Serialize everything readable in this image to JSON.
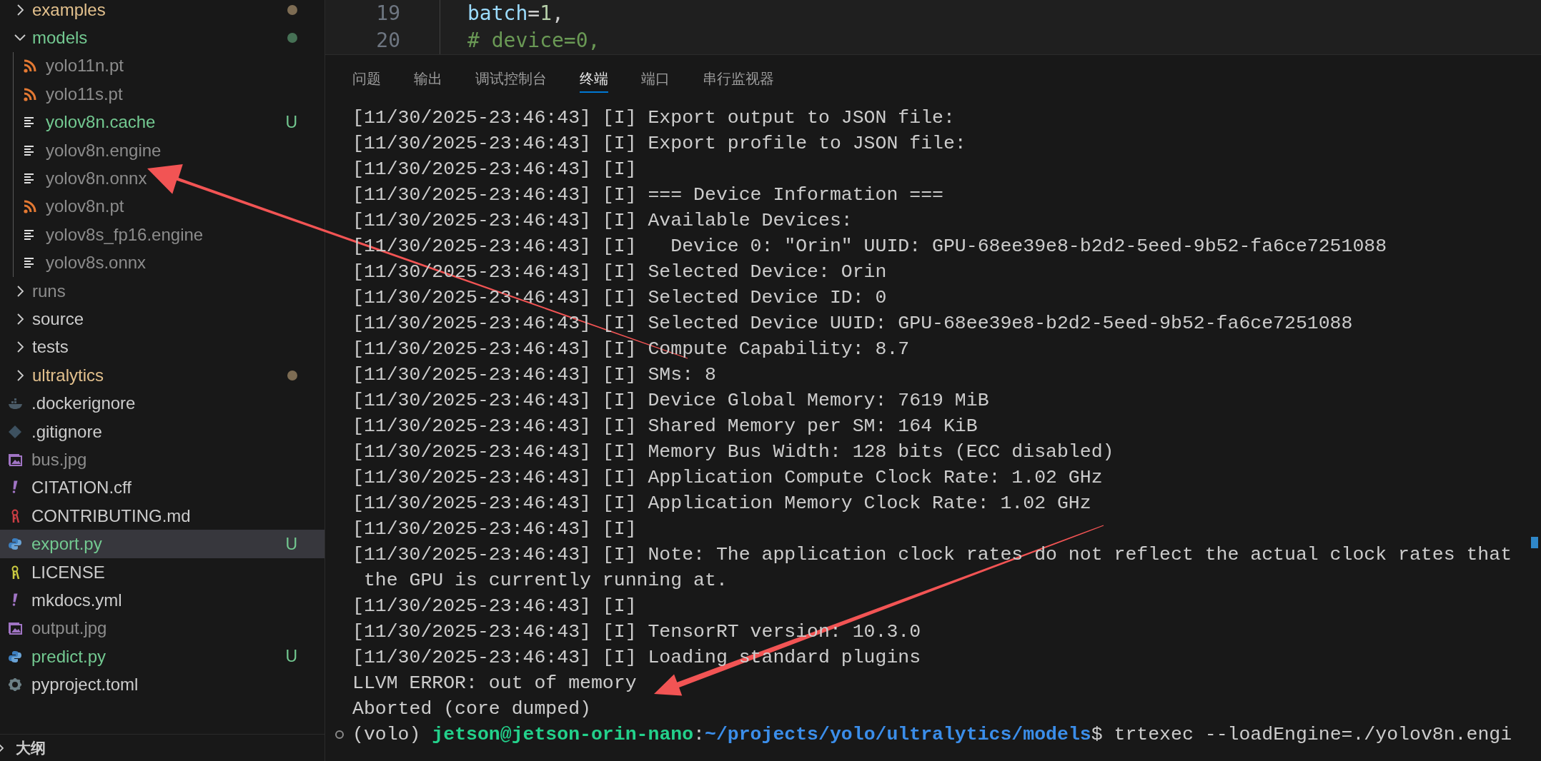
{
  "explorer": {
    "items": [
      {
        "label": "examples",
        "kind": "folder",
        "expanded": false,
        "color": "#e2c08d",
        "dot": true
      },
      {
        "label": "models",
        "kind": "folder",
        "expanded": true,
        "color": "#73c991",
        "dot": true,
        "children": [
          {
            "label": "yolo11n.pt",
            "kind": "pytorch",
            "color": "#8c8c8c"
          },
          {
            "label": "yolo11s.pt",
            "kind": "pytorch",
            "color": "#8c8c8c"
          },
          {
            "label": "yolov8n.cache",
            "kind": "data",
            "color": "#73c991",
            "badge": "U"
          },
          {
            "label": "yolov8n.engine",
            "kind": "data",
            "color": "#8c8c8c"
          },
          {
            "label": "yolov8n.onnx",
            "kind": "data",
            "color": "#8c8c8c"
          },
          {
            "label": "yolov8n.pt",
            "kind": "pytorch",
            "color": "#8c8c8c"
          },
          {
            "label": "yolov8s_fp16.engine",
            "kind": "data",
            "color": "#8c8c8c"
          },
          {
            "label": "yolov8s.onnx",
            "kind": "data",
            "color": "#8c8c8c"
          }
        ]
      },
      {
        "label": "runs",
        "kind": "folder",
        "expanded": false,
        "color": "#8c8c8c"
      },
      {
        "label": "source",
        "kind": "folder",
        "expanded": false,
        "color": "#cccccc"
      },
      {
        "label": "tests",
        "kind": "folder",
        "expanded": false,
        "color": "#cccccc"
      },
      {
        "label": "ultralytics",
        "kind": "folder",
        "expanded": false,
        "color": "#e2c08d",
        "dot": true
      },
      {
        "label": ".dockerignore",
        "kind": "docker",
        "color": "#cccccc"
      },
      {
        "label": ".gitignore",
        "kind": "gitignore",
        "color": "#cccccc"
      },
      {
        "label": "bus.jpg",
        "kind": "image",
        "color": "#8c8c8c"
      },
      {
        "label": "CITATION.cff",
        "kind": "yaml",
        "color": "#cccccc"
      },
      {
        "label": "CONTRIBUTING.md",
        "kind": "markdown",
        "color": "#cccccc"
      },
      {
        "label": "export.py",
        "kind": "python",
        "color": "#73c991",
        "badge": "U",
        "selected": true
      },
      {
        "label": "LICENSE",
        "kind": "license",
        "color": "#cccccc"
      },
      {
        "label": "mkdocs.yml",
        "kind": "yaml",
        "color": "#cccccc"
      },
      {
        "label": "output.jpg",
        "kind": "image",
        "color": "#8c8c8c"
      },
      {
        "label": "predict.py",
        "kind": "python",
        "color": "#73c991",
        "badge": "U"
      },
      {
        "label": "pyproject.toml",
        "kind": "toml",
        "color": "#cccccc"
      }
    ]
  },
  "outline": {
    "label": "大纲",
    "expanded": false
  },
  "editor": {
    "lines": [
      {
        "number": "19",
        "tokens": [
          {
            "kind": "variable",
            "text": "batch"
          },
          {
            "kind": "plain",
            "text": "="
          },
          {
            "kind": "number",
            "text": "1"
          },
          {
            "kind": "plain",
            "text": ","
          }
        ]
      },
      {
        "number": "20",
        "tokens": [
          {
            "kind": "comment",
            "text": "# device=0,"
          }
        ]
      }
    ]
  },
  "panel": {
    "tabs": [
      {
        "label": "问题",
        "selected": false
      },
      {
        "label": "输出",
        "selected": false
      },
      {
        "label": "调试控制台",
        "selected": false
      },
      {
        "label": "终端",
        "selected": true
      },
      {
        "label": "端口",
        "selected": false
      },
      {
        "label": "串行监视器",
        "selected": false
      }
    ]
  },
  "terminal": {
    "lines": [
      "[11/30/2025-23:46:43] [I] Export output to JSON file:",
      "[11/30/2025-23:46:43] [I] Export profile to JSON file:",
      "[11/30/2025-23:46:43] [I]",
      "[11/30/2025-23:46:43] [I] === Device Information ===",
      "[11/30/2025-23:46:43] [I] Available Devices:",
      "[11/30/2025-23:46:43] [I]   Device 0: \"Orin\" UUID: GPU-68ee39e8-b2d2-5eed-9b52-fa6ce7251088",
      "[11/30/2025-23:46:43] [I] Selected Device: Orin",
      "[11/30/2025-23:46:43] [I] Selected Device ID: 0",
      "[11/30/2025-23:46:43] [I] Selected Device UUID: GPU-68ee39e8-b2d2-5eed-9b52-fa6ce7251088",
      "[11/30/2025-23:46:43] [I] Compute Capability: 8.7",
      "[11/30/2025-23:46:43] [I] SMs: 8",
      "[11/30/2025-23:46:43] [I] Device Global Memory: 7619 MiB",
      "[11/30/2025-23:46:43] [I] Shared Memory per SM: 164 KiB",
      "[11/30/2025-23:46:43] [I] Memory Bus Width: 128 bits (ECC disabled)",
      "[11/30/2025-23:46:43] [I] Application Compute Clock Rate: 1.02 GHz",
      "[11/30/2025-23:46:43] [I] Application Memory Clock Rate: 1.02 GHz",
      "[11/30/2025-23:46:43] [I]",
      "[11/30/2025-23:46:43] [I] Note: The application clock rates do not reflect the actual clock rates that",
      " the GPU is currently running at.",
      "[11/30/2025-23:46:43] [I]",
      "[11/30/2025-23:46:43] [I] TensorRT version: 10.3.0",
      "[11/30/2025-23:46:43] [I] Loading standard plugins",
      "LLVM ERROR: out of memory",
      "Aborted (core dumped)"
    ],
    "prompt": [
      {
        "kind": "plain",
        "text": "(volo) "
      },
      {
        "kind": "user",
        "text": "jetson@jetson-orin-nano"
      },
      {
        "kind": "plain",
        "text": ":"
      },
      {
        "kind": "path",
        "text": "~/projects/yolo/ultralytics/models"
      },
      {
        "kind": "plain",
        "text": "$ trtexec --loadEngine=./yolov8n.engi"
      }
    ]
  }
}
